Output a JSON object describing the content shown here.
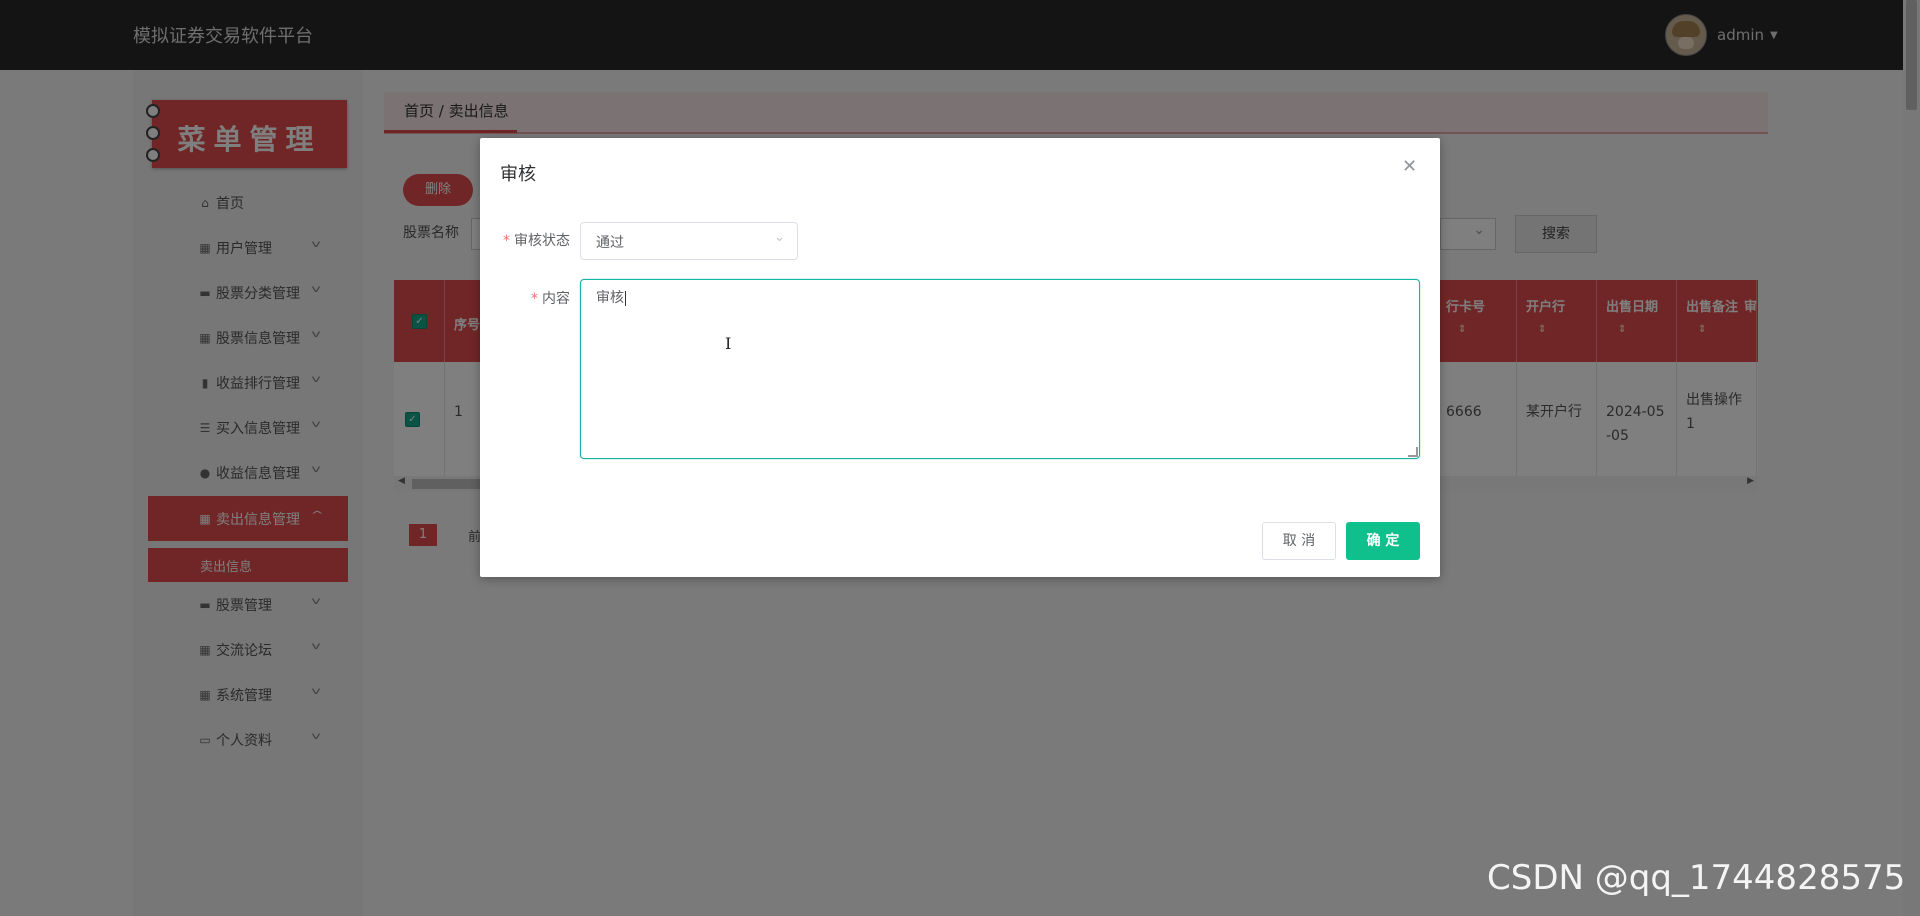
{
  "app": {
    "title": "模拟证券交易软件平台",
    "user": "admin"
  },
  "sidebar": {
    "header": "菜单管理",
    "items": [
      {
        "label": "首页",
        "icon": "home-icon",
        "glyph": "⌂"
      },
      {
        "label": "用户管理",
        "icon": "grid-icon",
        "glyph": "▦"
      },
      {
        "label": "股票分类管理",
        "icon": "chat-icon",
        "glyph": "▬"
      },
      {
        "label": "股票信息管理",
        "icon": "grid-icon",
        "glyph": "▦"
      },
      {
        "label": "收益排行管理",
        "icon": "chart-icon",
        "glyph": "▮"
      },
      {
        "label": "买入信息管理",
        "icon": "sliders-icon",
        "glyph": "☰"
      },
      {
        "label": "收益信息管理",
        "icon": "location-icon",
        "glyph": "●"
      },
      {
        "label": "卖出信息管理",
        "icon": "grid-icon",
        "glyph": "▦"
      },
      {
        "label": "股票管理",
        "icon": "chat-icon",
        "glyph": "▬"
      },
      {
        "label": "交流论坛",
        "icon": "grid-icon",
        "glyph": "▦"
      },
      {
        "label": "系统管理",
        "icon": "grid-icon",
        "glyph": "▦"
      },
      {
        "label": "个人资料",
        "icon": "card-icon",
        "glyph": "▭"
      }
    ],
    "submenu_label": "卖出信息"
  },
  "breadcrumb": "首页 / 卖出信息",
  "toolbar": {
    "delete": "删除",
    "filter_label": "股票名称",
    "search": "搜索"
  },
  "table": {
    "headers": {
      "index": "序号",
      "card": "行卡号",
      "bank": "开户行",
      "date": "出售日期",
      "note": "出售备注",
      "audit": "审"
    },
    "row": {
      "index": "1",
      "card": "6666",
      "bank": "某开户行",
      "date": "2024-05-05",
      "note": "出售操作1"
    }
  },
  "pagination": {
    "current": "1",
    "prev": "前"
  },
  "dialog": {
    "title": "审核",
    "status_label": "审核状态",
    "status_value": "通过",
    "content_label": "内容",
    "content_value": "审核",
    "cancel": "取 消",
    "confirm": "确 定"
  },
  "watermark": "CSDN @qq_1744828575",
  "colors": {
    "accent": "#e04d4d",
    "confirm": "#0fbf8c",
    "focus": "#17b3a3"
  }
}
